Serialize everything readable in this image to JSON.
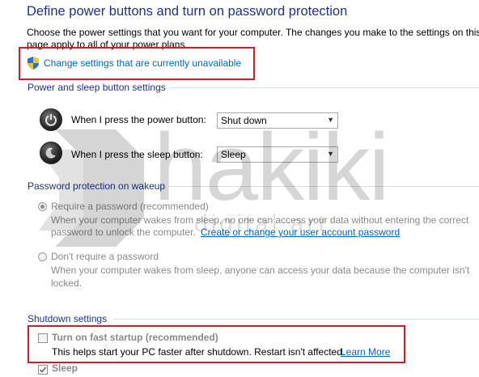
{
  "header": {
    "title": "Define power buttons and turn on password protection",
    "description_line1": "Choose the power settings that you want for your computer. The changes you make to the settings on this",
    "description_line2": "page apply to all of your power plans."
  },
  "change_settings_link": {
    "label": "Change settings that are currently unavailable",
    "icon": "shield-icon"
  },
  "power_sleep": {
    "section_label": "Power and sleep button settings",
    "power_button_label": "When I press the power button:",
    "power_button_value": "Shut down",
    "sleep_button_label": "When I press the sleep button:",
    "sleep_button_value": "Sleep"
  },
  "password": {
    "section_label": "Password protection on wakeup",
    "require_label": "Require a password (recommended)",
    "require_desc1": "When your computer wakes from sleep, no one can access your data without entering the correct",
    "require_desc2": "password to unlock the computer.",
    "account_link": "Create or change your user account password",
    "no_require_label": "Don't require a password",
    "no_require_desc1": "When your computer wakes from sleep, anyone can access your data because the computer isn't",
    "no_require_desc2": "locked."
  },
  "shutdown": {
    "section_label": "Shutdown settings",
    "fast_startup_label": "Turn on fast startup (recommended)",
    "fast_startup_desc": "This helps start your PC faster after shutdown. Restart isn't affected.",
    "learn_more": "Learn More",
    "fast_startup_checked": false,
    "sleep_label": "Sleep",
    "sleep_checked": true
  },
  "watermark": {
    "brand": "hakiki",
    "sub": "digital art"
  },
  "colors": {
    "title": "#1e3287",
    "link": "#0066cc",
    "highlight": "#cc1f2b",
    "divider": "#d5dfe5"
  }
}
